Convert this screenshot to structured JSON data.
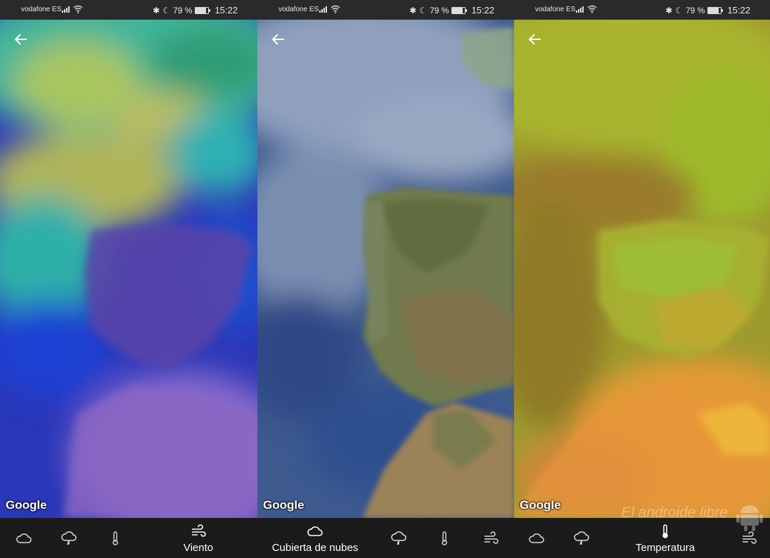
{
  "status_bar": {
    "carrier": "vodafone ES",
    "battery": "79 %",
    "battery_level": 0.79,
    "time": "15:22"
  },
  "map_attribution": "Google",
  "panels": [
    {
      "active_tab": "Viento"
    },
    {
      "active_tab": "Cubierta de nubes"
    },
    {
      "active_tab": "Temperatura"
    }
  ],
  "watermark": "El androide libre",
  "icons": {
    "back": "arrow-left-icon",
    "cloud": "cloud-icon",
    "rain": "cloud-rain-icon",
    "temp": "thermometer-icon",
    "wind": "wind-icon"
  }
}
